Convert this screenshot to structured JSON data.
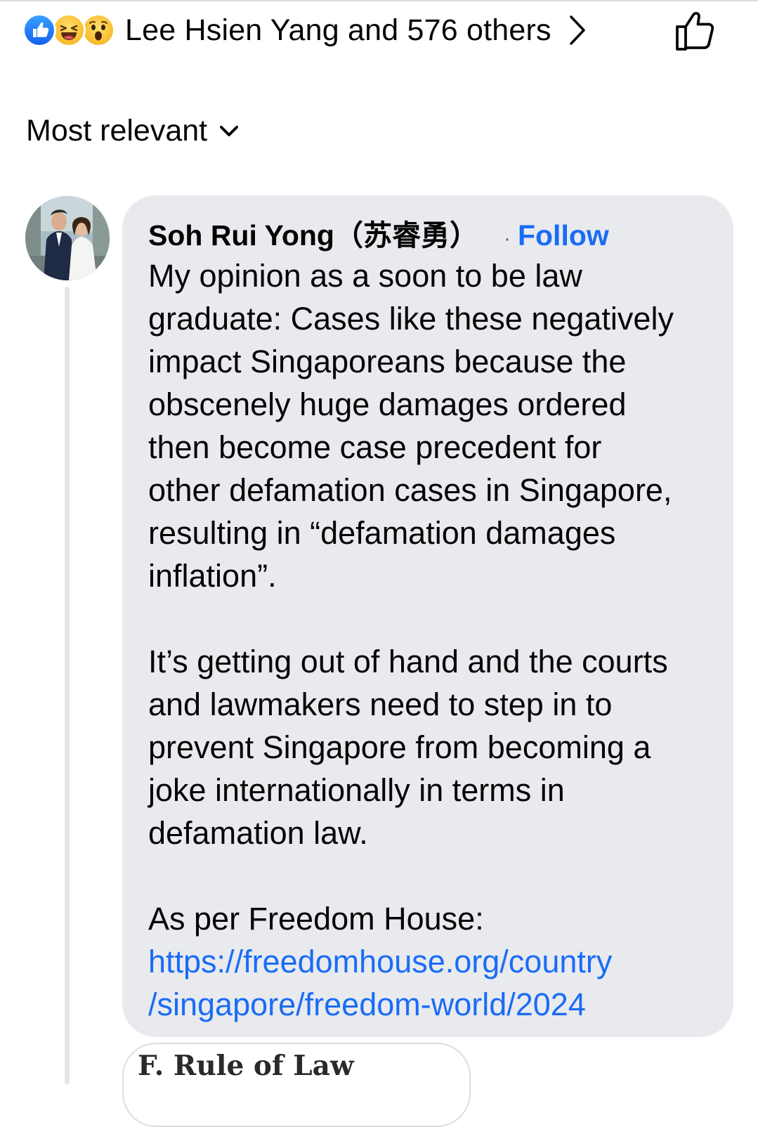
{
  "reactions": {
    "icons": [
      "like-icon",
      "haha-icon",
      "wow-icon"
    ],
    "summary": "Lee Hsien Yang and 576 others"
  },
  "sort": {
    "label": "Most relevant"
  },
  "comment": {
    "author": "Soh Rui Yong（苏睿勇）",
    "separator": "·",
    "follow_label": "Follow",
    "paragraph_1_lines": [
      "My opinion as a soon to be law",
      "graduate: Cases like these negatively",
      "impact Singaporeans because the",
      "obscenely huge damages ordered",
      "then become case precedent for",
      "other defamation cases in Singapore,",
      "resulting in “defamation damages",
      "inflation”."
    ],
    "paragraph_2_lines": [
      "It’s getting out of hand and the courts",
      "and lawmakers need to step in to",
      "prevent Singapore from becoming a",
      "joke internationally in terms in",
      "defamation law."
    ],
    "paragraph_3_intro": "As per Freedom House:",
    "link_lines": [
      "https://freedomhouse.org/country",
      "/singapore/freedom-world/2024"
    ]
  },
  "link_preview": {
    "title": "F. Rule of Law"
  },
  "colors": {
    "accent": "#1a6cf5",
    "bubble_bg": "#e9eaee",
    "text": "#050505",
    "like_blue": "#1361f1"
  }
}
